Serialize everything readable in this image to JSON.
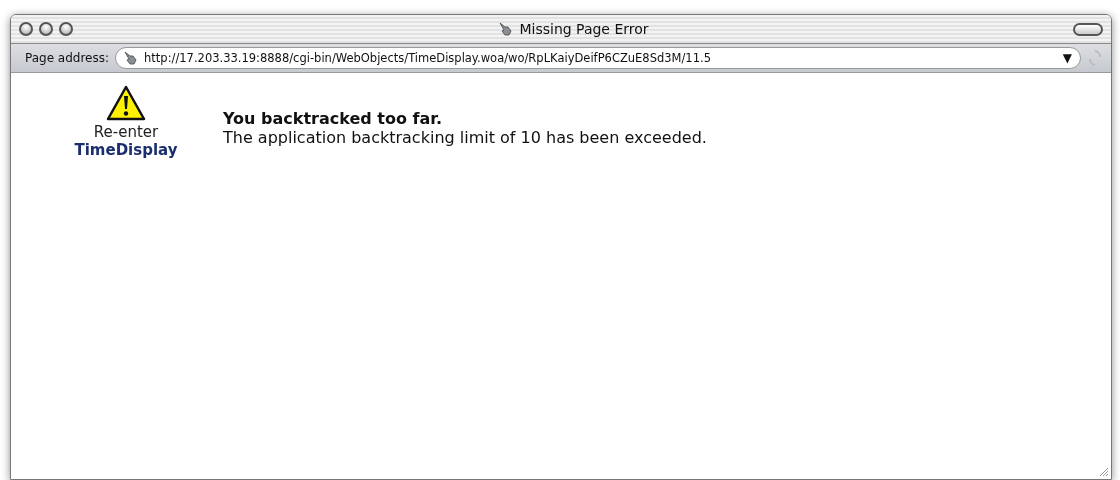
{
  "window": {
    "title": "Missing Page Error"
  },
  "address_bar": {
    "label": "Page address:",
    "value": "http://17.203.33.19:8888/cgi-bin/WebObjects/TimeDisplay.woa/wo/RpLKaiyDeifP6CZuE8Sd3M/11.5",
    "menu_glyph": "▼"
  },
  "sidebar": {
    "text": "Re-enter",
    "link": "TimeDisplay"
  },
  "message": {
    "heading": "You backtracked too far.",
    "body": "The application backtracking limit of 10 has been exceeded."
  }
}
